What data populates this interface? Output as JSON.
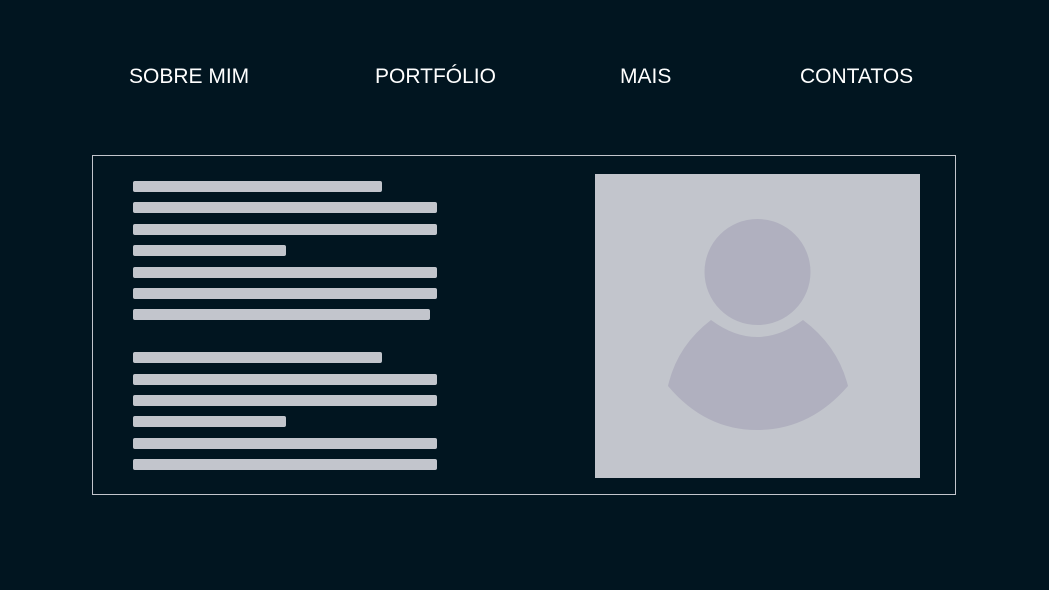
{
  "nav": {
    "items": [
      {
        "label": "SOBRE MIM"
      },
      {
        "label": "PORTFÓLIO"
      },
      {
        "label": "MAIS"
      },
      {
        "label": "CONTATOS"
      }
    ]
  },
  "colors": {
    "background": "#011520",
    "nav_text": "#ffffff",
    "placeholder": "#c2c5cc",
    "avatar": "#b0b0bf",
    "card_border": "#c2c5cc"
  },
  "about": {
    "image_icon": "user-silhouette-icon"
  }
}
